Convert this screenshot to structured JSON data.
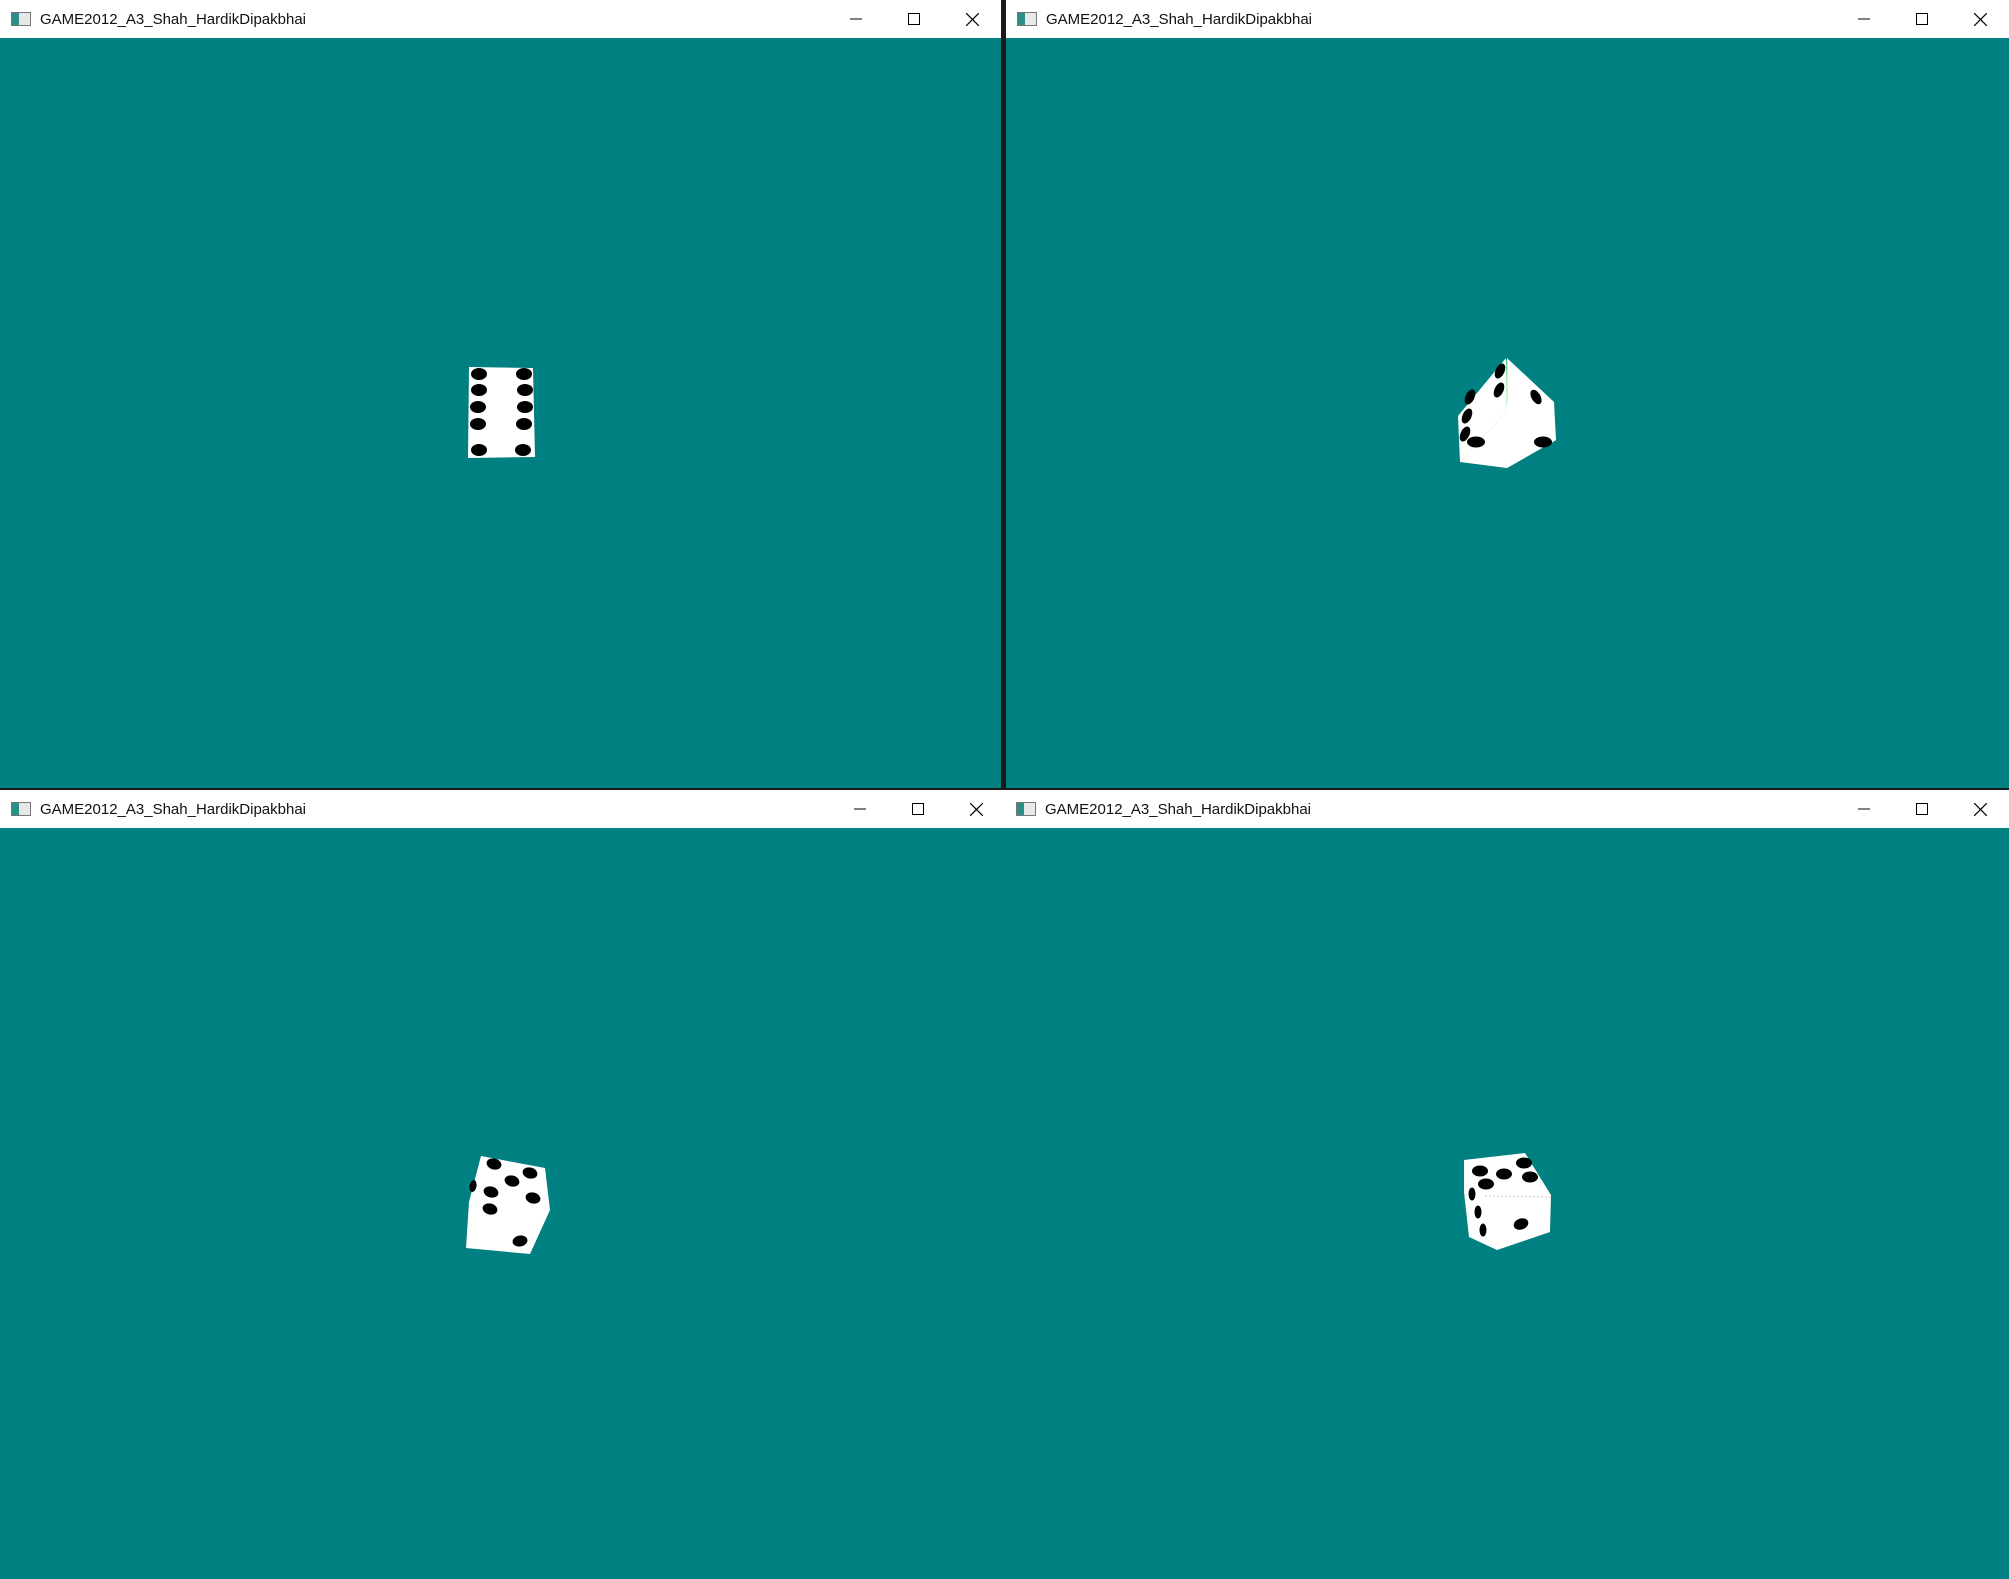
{
  "app": {
    "window_title": "GAME2012_A3_Shah_HardikDipakbhai",
    "client_color": "#008080",
    "die_face_color": "#ffffff",
    "pip_color": "#000000"
  },
  "windows": [
    {
      "id": "top-left",
      "title": "GAME2012_A3_Shah_HardikDipakbhai",
      "visible_face": "six"
    },
    {
      "id": "top-right",
      "title": "GAME2012_A3_Shah_HardikDipakbhai",
      "visible_faces": "four and two"
    },
    {
      "id": "bottom-left",
      "title": "GAME2012_A3_Shah_HardikDipakbhai",
      "visible_faces": "five and one"
    },
    {
      "id": "bottom-right",
      "title": "GAME2012_A3_Shah_HardikDipakbhai",
      "visible_faces": "five and three"
    }
  ],
  "icons": {
    "app": "app-window-icon",
    "minimize": "minimize-icon",
    "maximize": "maximize-icon",
    "close": "close-icon"
  }
}
